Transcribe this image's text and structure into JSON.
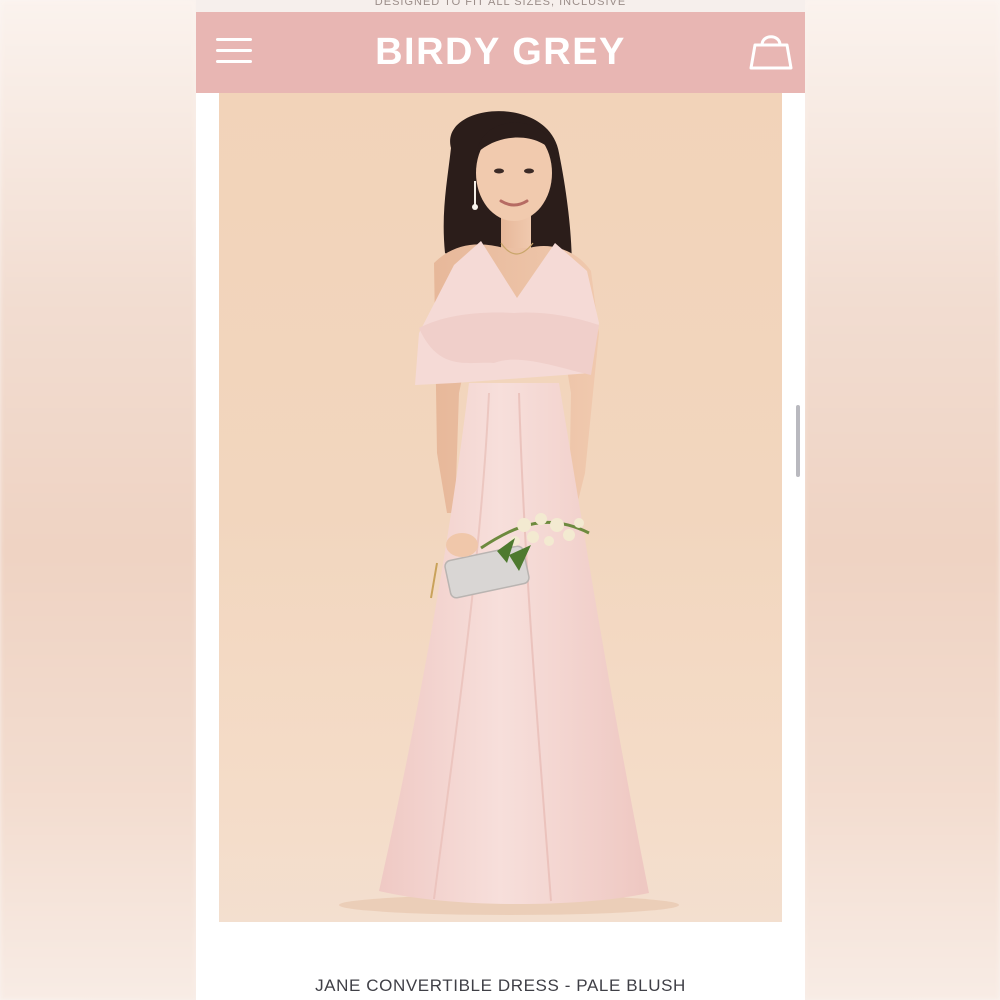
{
  "header": {
    "brand": "BIRDY GREY",
    "menu_icon": "hamburger-menu-icon",
    "cart_icon": "shopping-bag-icon",
    "background": "#e8b6b3"
  },
  "promo": {
    "text": "DESIGNED TO FIT ALL SIZES, INCLUSIVE"
  },
  "product": {
    "title": "JANE CONVERTIBLE DRESS - PALE BLUSH",
    "dress_color": "#f4d6d2",
    "backdrop_color": "#f2d3b9"
  }
}
